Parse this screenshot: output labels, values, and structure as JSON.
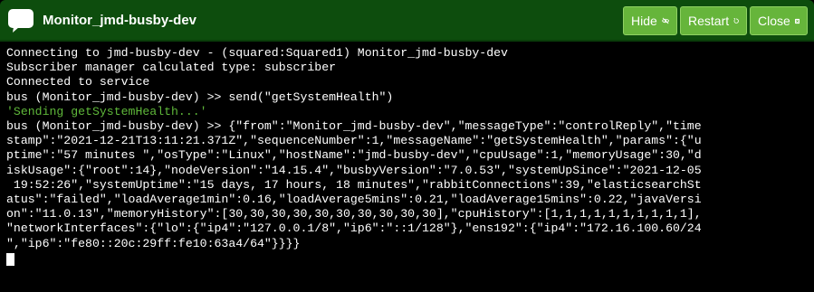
{
  "window": {
    "title": "Monitor_jmd-busby-dev",
    "colors": {
      "titlebar": "#0d4d0d",
      "button": "#66b53b",
      "console_bg": "#000000",
      "console_text": "#ffffff",
      "console_echo": "#5fb83a"
    }
  },
  "toolbar": {
    "hide_label": "Hide",
    "hide_icon": "eye-slash-icon",
    "restart_label": "Restart",
    "restart_icon": "restart-icon",
    "close_label": "Close",
    "close_icon": "close-box-icon"
  },
  "console": {
    "lines": [
      {
        "text": "Connecting to jmd-busby-dev - (squared:Squared1) Monitor_jmd-busby-dev",
        "style": "normal"
      },
      {
        "text": "Subscriber manager calculated type: subscriber",
        "style": "normal"
      },
      {
        "text": "Connected to service",
        "style": "normal"
      },
      {
        "text": "bus (Monitor_jmd-busby-dev) >> send(\"getSystemHealth\")",
        "style": "normal"
      },
      {
        "text": "'Sending getSystemHealth...'",
        "style": "green"
      },
      {
        "text": "bus (Monitor_jmd-busby-dev) >> {\"from\":\"Monitor_jmd-busby-dev\",\"messageType\":\"controlReply\",\"time",
        "style": "normal"
      },
      {
        "text": "stamp\":\"2021-12-21T13:11:21.371Z\",\"sequenceNumber\":1,\"messageName\":\"getSystemHealth\",\"params\":{\"u",
        "style": "normal"
      },
      {
        "text": "ptime\":\"57 minutes \",\"osType\":\"Linux\",\"hostName\":\"jmd-busby-dev\",\"cpuUsage\":1,\"memoryUsage\":30,\"d",
        "style": "normal"
      },
      {
        "text": "iskUsage\":{\"root\":14},\"nodeVersion\":\"14.15.4\",\"busbyVersion\":\"7.0.53\",\"systemUpSince\":\"2021-12-05",
        "style": "normal"
      },
      {
        "text": " 19:52:26\",\"systemUptime\":\"15 days, 17 hours, 18 minutes\",\"rabbitConnections\":39,\"elasticsearchSt",
        "style": "normal"
      },
      {
        "text": "atus\":\"failed\",\"loadAverage1min\":0.16,\"loadAverage5mins\":0.21,\"loadAverage15mins\":0.22,\"javaVersi",
        "style": "normal"
      },
      {
        "text": "on\":\"11.0.13\",\"memoryHistory\":[30,30,30,30,30,30,30,30,30,30],\"cpuHistory\":[1,1,1,1,1,1,1,1,1,1],",
        "style": "normal"
      },
      {
        "text": "\"networkInterfaces\":{\"lo\":{\"ip4\":\"127.0.0.1/8\",\"ip6\":\"::1/128\"},\"ens192\":{\"ip4\":\"172.16.100.60/24",
        "style": "normal"
      },
      {
        "text": "\",\"ip6\":\"fe80::20c:29ff:fe10:63a4/64\"}}}}",
        "style": "normal"
      }
    ]
  }
}
